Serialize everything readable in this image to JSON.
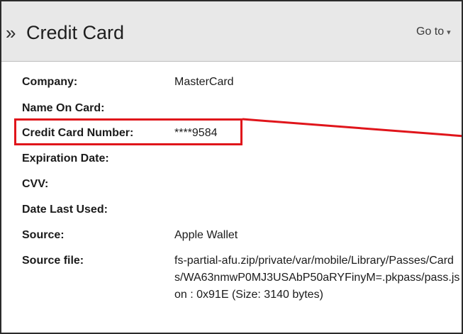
{
  "header": {
    "title": "Credit Card",
    "goto_label": "Go to",
    "expand_icon": "double-chevron-right-icon",
    "goto_icon": "chevron-down-icon"
  },
  "fields": [
    {
      "label": "Company:",
      "value": "MasterCard"
    },
    {
      "label": "Name On Card:",
      "value": ""
    },
    {
      "label": "Credit Card Number:",
      "value": "****9584"
    },
    {
      "label": "Expiration Date:",
      "value": ""
    },
    {
      "label": "CVV:",
      "value": ""
    },
    {
      "label": "Date Last Used:",
      "value": ""
    },
    {
      "label": "Source:",
      "value": "Apple Wallet"
    },
    {
      "label": "Source file:",
      "value": "fs-partial-afu.zip/private/var/mobile/Library/Passes/Cards/WA63nmwP0MJ3USAbP50aRYFinyM=.pkpass/pass.json : 0x91E (Size: 3140 bytes)"
    }
  ],
  "annotation": {
    "highlight_color": "#e0151b"
  }
}
